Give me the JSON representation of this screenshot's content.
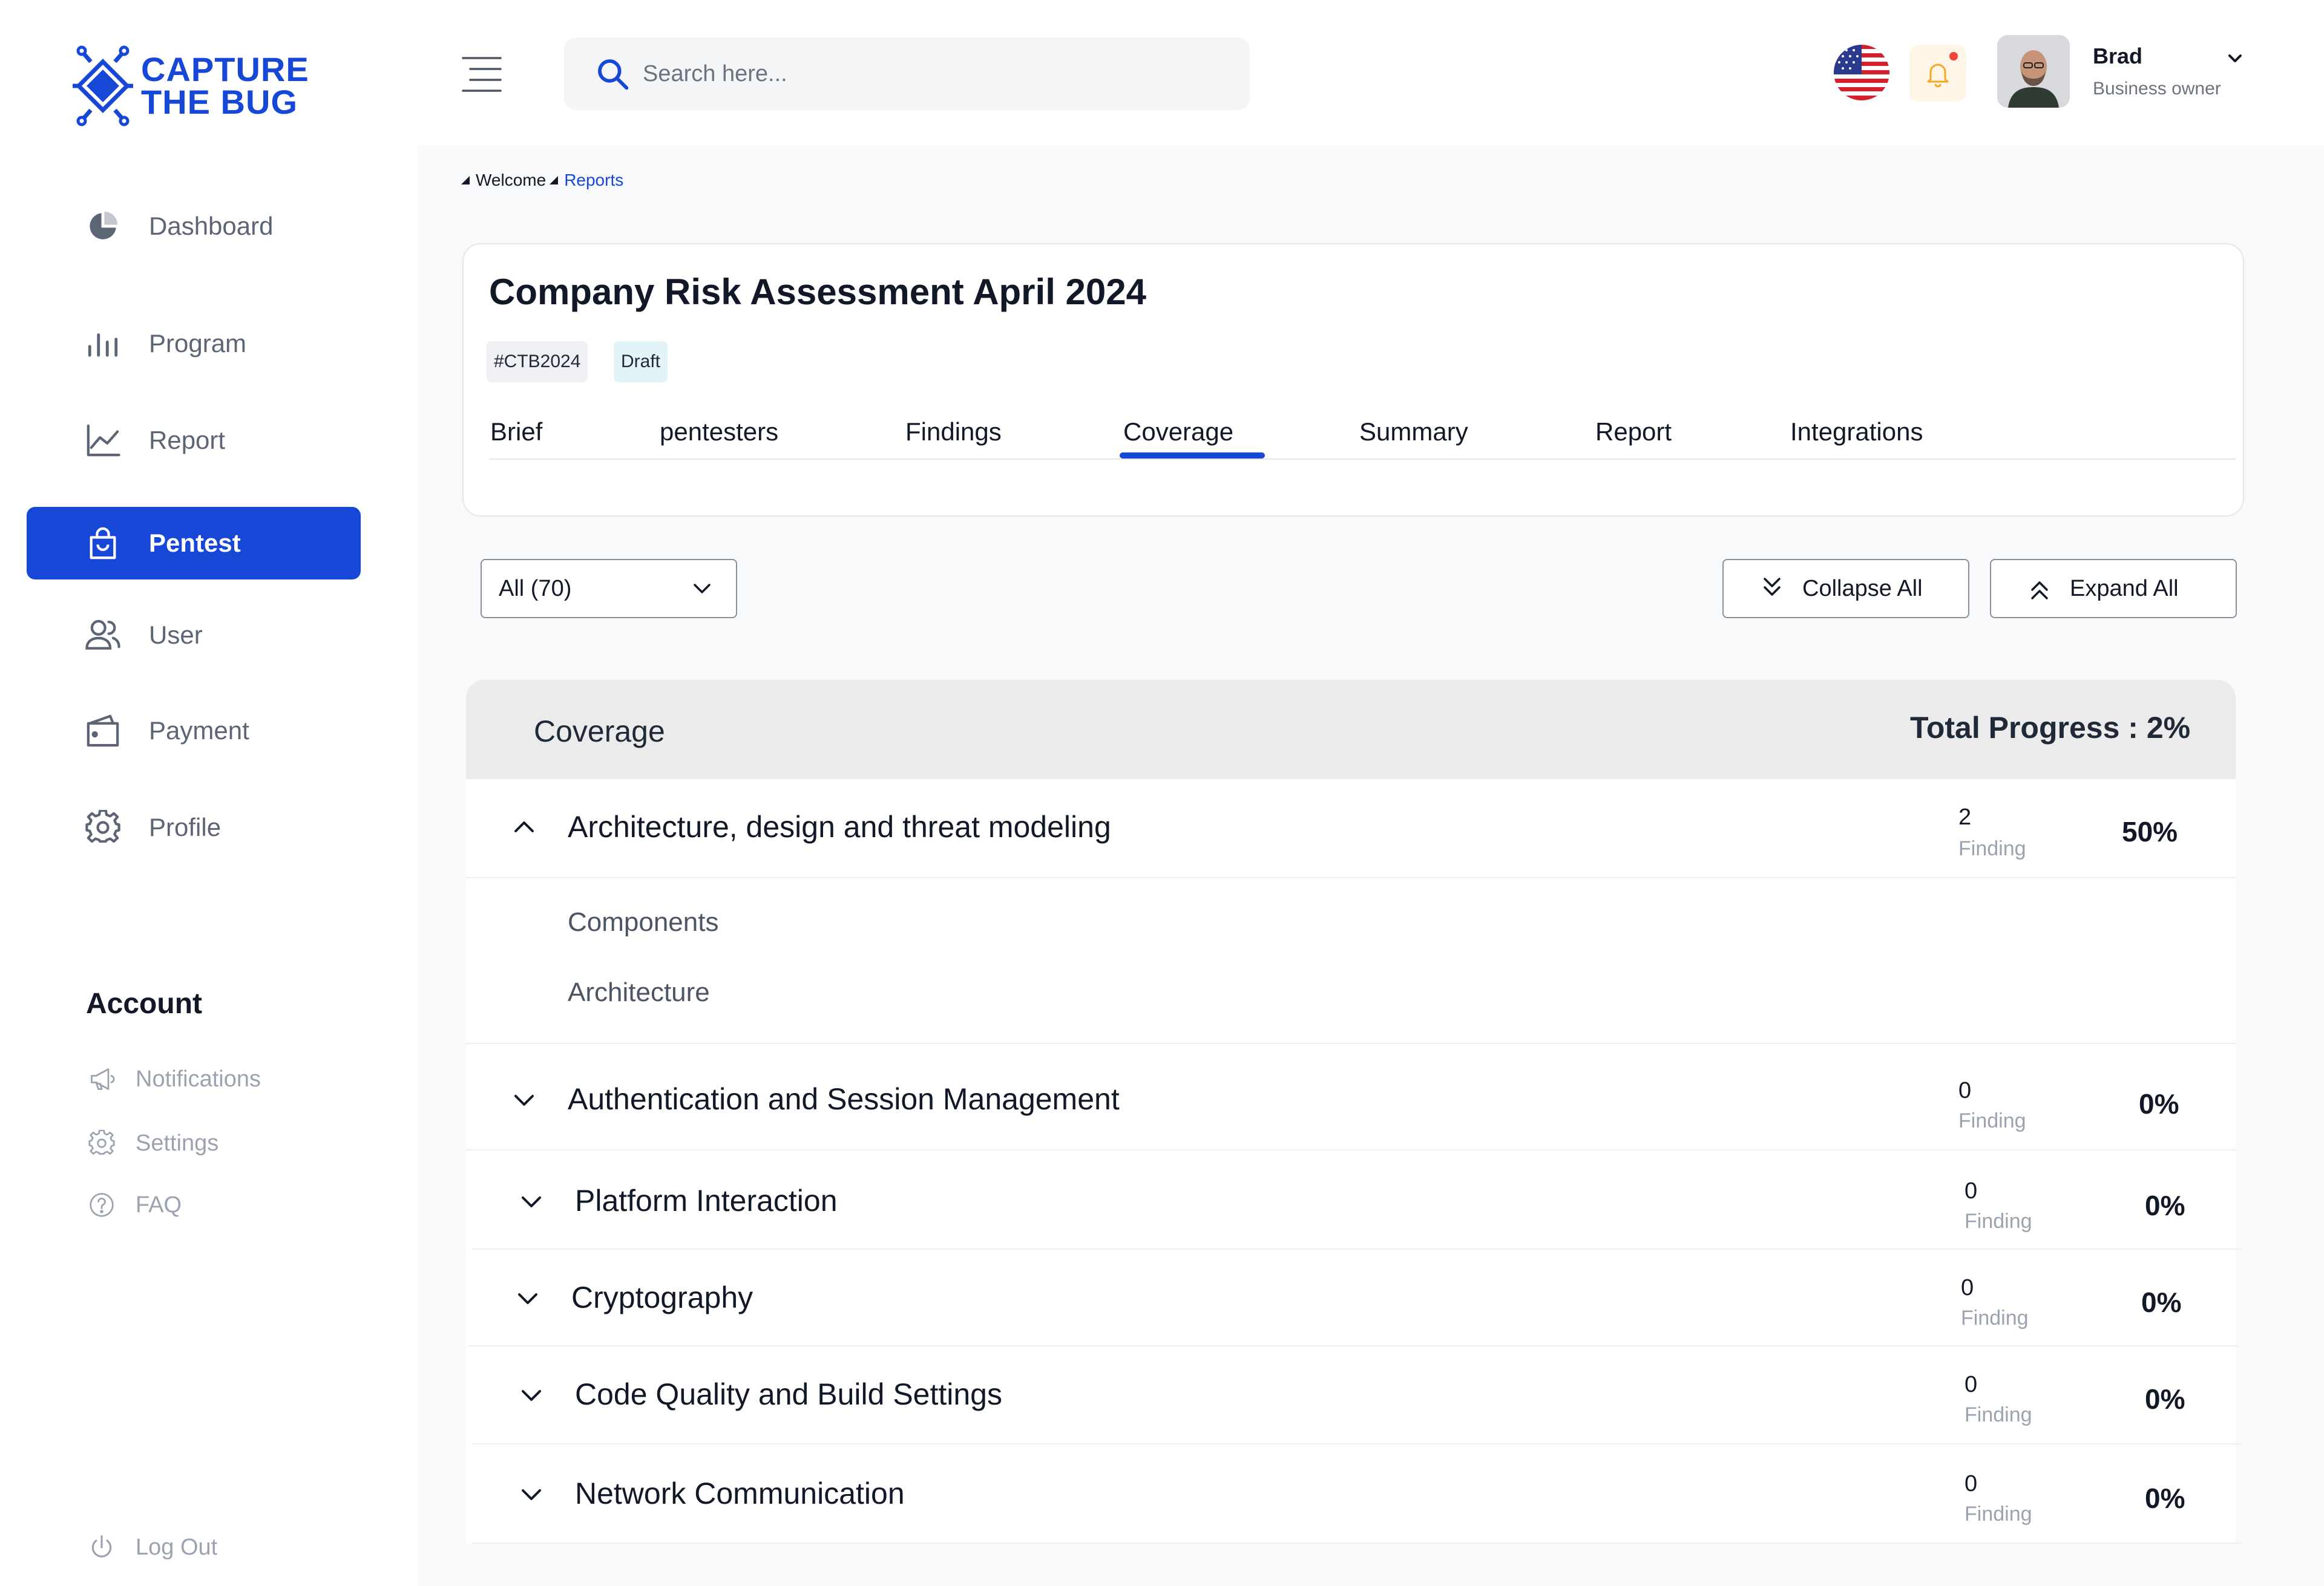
{
  "brand": {
    "line1": "CAPTURE",
    "line2": "THE BUG",
    "color": "#1747d6"
  },
  "sidebar": {
    "items": [
      {
        "label": "Dashboard",
        "icon": "pie-chart-icon"
      },
      {
        "label": "Program",
        "icon": "bar-chart-icon"
      },
      {
        "label": "Report",
        "icon": "line-chart-icon"
      },
      {
        "label": "Pentest",
        "icon": "shopping-bag-icon",
        "active": true
      },
      {
        "label": "User",
        "icon": "users-icon"
      },
      {
        "label": "Payment",
        "icon": "wallet-icon"
      },
      {
        "label": "Profile",
        "icon": "gear-icon"
      }
    ],
    "account_title": "Account",
    "account_items": [
      {
        "label": "Notifications",
        "icon": "megaphone-icon"
      },
      {
        "label": "Settings",
        "icon": "gear-icon"
      },
      {
        "label": "FAQ",
        "icon": "question-icon"
      }
    ],
    "logout": "Log Out"
  },
  "header": {
    "search_placeholder": "Search here...",
    "user_name": "Brad",
    "user_role": "Business owner"
  },
  "breadcrumb": {
    "home": "Welcome",
    "current": "Reports"
  },
  "assessment": {
    "title": "Company Risk Assessment April 2024",
    "code_tag": "#CTB2024",
    "status_tag": "Draft",
    "tabs": [
      "Brief",
      "pentesters",
      "Findings",
      "Coverage",
      "Summary",
      "Report",
      "Integrations"
    ],
    "active_tab": "Coverage"
  },
  "toolbar": {
    "filter_value": "All (70)",
    "collapse_label": "Collapse All",
    "expand_label": "Expand All"
  },
  "coverage": {
    "title": "Coverage",
    "total_progress": "Total Progress : 2%",
    "finding_label": "Finding",
    "categories": [
      {
        "name": "Architecture, design and threat modeling",
        "findings": "2",
        "percent": "50%",
        "expanded": true,
        "children": [
          "Components",
          "Architecture"
        ]
      },
      {
        "name": "Authentication and Session Management",
        "findings": "0",
        "percent": "0%",
        "expanded": false
      },
      {
        "name": "Platform Interaction",
        "findings": "0",
        "percent": "0%",
        "expanded": false
      },
      {
        "name": "Cryptography",
        "findings": "0",
        "percent": "0%",
        "expanded": false
      },
      {
        "name": "Code Quality and Build Settings",
        "findings": "0",
        "percent": "0%",
        "expanded": false
      },
      {
        "name": "Network Communication",
        "findings": "0",
        "percent": "0%",
        "expanded": false
      }
    ]
  },
  "colors": {
    "accent": "#1747d6",
    "notification_dot": "#f04438",
    "coverage_header_bg": "#ebebec"
  }
}
